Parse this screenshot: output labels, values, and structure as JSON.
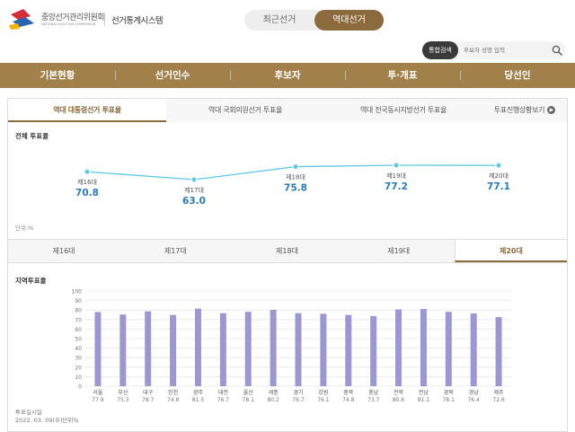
{
  "header": {
    "org_name": "중앙선거관리위원회",
    "org_name_en": "NATIONAL ELECTION COMMISSION",
    "system_title": "선거통계시스템",
    "toggle": {
      "recent_label": "최근선거",
      "history_label": "역대선거",
      "selected": "역대선거"
    }
  },
  "search": {
    "label": "통합검색",
    "placeholder": "후보자 성명 입력",
    "icon": "search-icon"
  },
  "nav": {
    "items": [
      "기본현황",
      "선거인수",
      "후보자",
      "투·개표",
      "당선인"
    ]
  },
  "tabs": {
    "items": [
      "역대 대통령선거 투표율",
      "역대 국회의원선거 투표율",
      "역대 전국동시지방선거 투표율",
      "투표진행상황보기"
    ],
    "active_index": 0
  },
  "overall": {
    "title": "전체 투표율",
    "unit_label": "단위:%",
    "chart_data": {
      "type": "line",
      "categories": [
        "제16대",
        "제17대",
        "제18대",
        "제19대",
        "제20대"
      ],
      "values": [
        70.8,
        63.0,
        75.8,
        77.2,
        77.1
      ],
      "title": "전체 투표율",
      "line_color": "#5fc6e6",
      "value_color": "#2a7ab8"
    }
  },
  "election_tabs": {
    "items": [
      "제16대",
      "제17대",
      "제18대",
      "제19대",
      "제20대"
    ],
    "active_index": 4
  },
  "regional": {
    "title": "지역투표율",
    "chart_data": {
      "type": "bar",
      "categories": [
        "서울",
        "부산",
        "대구",
        "인천",
        "광주",
        "대전",
        "울산",
        "세종",
        "경기",
        "강원",
        "충북",
        "충남",
        "전북",
        "전남",
        "경북",
        "경남",
        "제주"
      ],
      "values": [
        77.9,
        75.3,
        78.7,
        74.8,
        81.5,
        76.7,
        78.1,
        80.2,
        76.7,
        76.1,
        74.8,
        73.7,
        80.6,
        81.1,
        78.1,
        76.4,
        72.6
      ],
      "yticks": [
        0,
        10,
        20,
        30,
        40,
        50,
        60,
        70,
        80,
        90,
        100
      ],
      "ylim": [
        0,
        100
      ],
      "bar_color": "#9b97d0"
    },
    "footnote_label": "투표실시일",
    "footnote_date": "2022. 03. 09(수)단위%"
  },
  "colors": {
    "brand": "#8b6a3d",
    "nav_bg": "#a2804a"
  }
}
